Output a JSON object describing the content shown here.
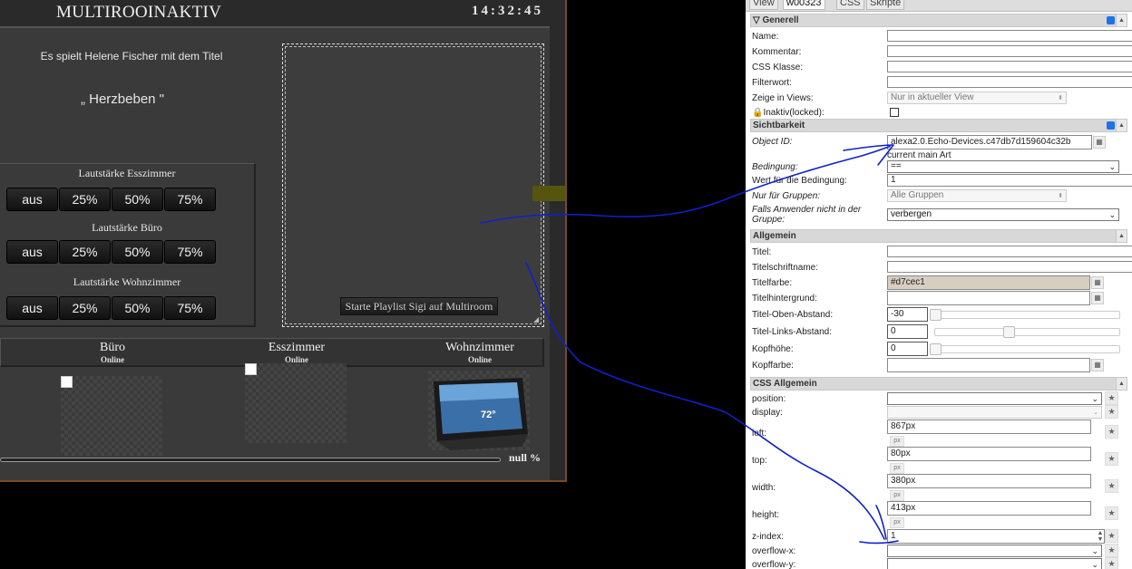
{
  "dashboard": {
    "title": "MULTIROOINAKTIV",
    "clock": "14:32:45",
    "now_playing_line": "Es spielt Helene Fischer mit dem Titel",
    "song_title": "„ Herzbeben \"",
    "volume_groups": [
      {
        "label": "Lautstärke Esszimmer",
        "buttons": [
          "aus",
          "25%",
          "50%",
          "75%"
        ]
      },
      {
        "label": "Lautstärke Büro",
        "buttons": [
          "aus",
          "25%",
          "50%",
          "75%"
        ]
      },
      {
        "label": "Lautstärke Wohnzimmer",
        "buttons": [
          "aus",
          "25%",
          "50%",
          "75%"
        ]
      }
    ],
    "playlist_button": "Starte Playlist Sigi auf Multiroom",
    "rooms": [
      {
        "name": "Büro",
        "status": "Online"
      },
      {
        "name": "Esszimmer",
        "status": "Online"
      },
      {
        "name": "Wohnzimmer",
        "status": "Online"
      }
    ],
    "device_screen_temp": "72°",
    "progress_text": "null %"
  },
  "inspector": {
    "tabs": [
      "View",
      "w00323",
      "CSS",
      "Skripte"
    ],
    "sections": {
      "generell": "Generell",
      "sichtbarkeit": "Sichtbarkeit",
      "allgemein": "Allgemein",
      "css_allgemein": "CSS Allgemein"
    },
    "generell": {
      "name_label": "Name:",
      "kommentar_label": "Kommentar:",
      "css_klasse_label": "CSS Klasse:",
      "filterwort_label": "Filterwort:",
      "zeige_label": "Zeige in Views:",
      "zeige_value": "Nur in aktueller View",
      "inaktiv_label": "Inaktiv(locked):"
    },
    "sichtbarkeit": {
      "object_id_label": "Object ID:",
      "object_id_value": "alexa2.0.Echo-Devices.c47db7d159604c32b",
      "object_id_hint": "current main Art",
      "bedingung_label": "Bedingung:",
      "bedingung_value": "==",
      "wert_label": "Wert für die Bedingung:",
      "wert_value": "1",
      "gruppen_label": "Nur für Gruppen:",
      "gruppen_value": "Alle Gruppen",
      "falls_label": "Falls Anwender nicht in der Gruppe:",
      "falls_value": "verbergen"
    },
    "allgemein": {
      "titel_label": "Titel:",
      "titelschrift_label": "Titelschriftname:",
      "titelfarbe_label": "Titelfarbe:",
      "titelfarbe_value": "#d7cec1",
      "titelhintergrund_label": "Titelhintergrund:",
      "oben_label": "Titel-Oben-Abstand:",
      "oben_value": "-30",
      "links_label": "Titel-Links-Abstand:",
      "links_value": "0",
      "kopfhoehe_label": "Kopfhöhe:",
      "kopfhoehe_value": "0",
      "kopffarbe_label": "Kopffarbe:"
    },
    "css": {
      "position_label": "position:",
      "display_label": "display:",
      "left_label": "left:",
      "left_value": "867px",
      "top_label": "top:",
      "top_value": "80px",
      "width_label": "width:",
      "width_value": "380px",
      "height_label": "height:",
      "height_value": "413px",
      "unit": "px",
      "zindex_label": "z-index:",
      "zindex_value": "1",
      "overflowx_label": "overflow-x:",
      "overflowy_label": "overflow-y:"
    }
  },
  "colors": {
    "titelfarbe_swatch": "#d7cec1",
    "annotation_ink": "#1020c8"
  }
}
